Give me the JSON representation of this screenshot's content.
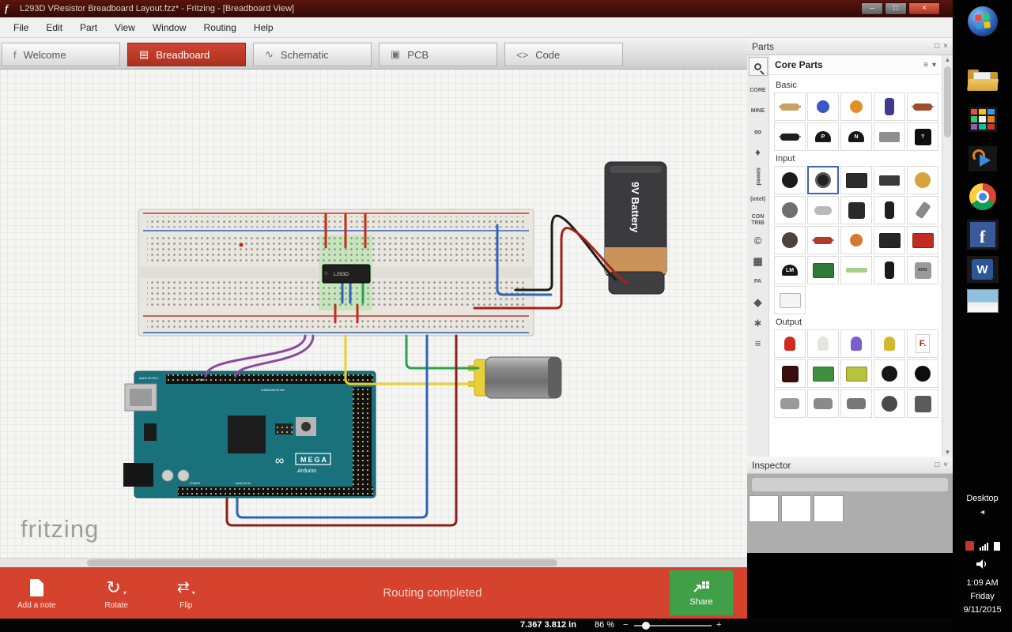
{
  "colors": {
    "accent_red": "#c0392b",
    "toolbar_red": "#d5432e",
    "share_green": "#3fa047",
    "selection_blue": "#3a66ad",
    "title_bar": "#3c0f0a"
  },
  "window": {
    "title": "L293D VResistor Breadboard Layout.fzz* - Fritzing - [Breadboard View]",
    "app_glyph": "f",
    "minimize_glyph": "–",
    "maximize_glyph": "□",
    "close_glyph": "×"
  },
  "menu": {
    "items": [
      "File",
      "Edit",
      "Part",
      "View",
      "Window",
      "Routing",
      "Help"
    ]
  },
  "tabs": [
    {
      "label": "Welcome",
      "icon": "f",
      "active": false
    },
    {
      "label": "Breadboard",
      "icon": "▤",
      "active": true
    },
    {
      "label": "Schematic",
      "icon": "∿",
      "active": false
    },
    {
      "label": "PCB",
      "icon": "▣",
      "active": false
    },
    {
      "label": "Code",
      "icon": "<>",
      "active": false
    }
  ],
  "canvas": {
    "watermark": "fritzing",
    "battery_label": "9V Battery",
    "chip_label": "L293D",
    "mega_label": "MEGA",
    "brand_label": "Arduino",
    "infinity_glyph": "∞",
    "made_in": "MADE IN ITALY",
    "communication": "COMMUNICATION",
    "pwm_label": "PWM",
    "analog_label": "ANALOG IN",
    "power_label": "POWER"
  },
  "parts_panel": {
    "title": "Parts",
    "bin_title": "Core Parts",
    "menu_glyph": "≡",
    "caret_glyph": "▾",
    "dock_glyph": "□",
    "close_glyph": "×",
    "scroll_up": "▲",
    "scroll_down": "▼",
    "side_tabs": [
      {
        "n": "bin-tab-core",
        "t": "CORE"
      },
      {
        "n": "bin-tab-mine",
        "t": "MINE"
      },
      {
        "n": "bin-tab-adafruit",
        "t": "∞",
        "big": true
      },
      {
        "n": "bin-tab-sparkfun",
        "t": "♦",
        "big": true
      },
      {
        "n": "bin-tab-seeed",
        "t": "seeed",
        "rot": true
      },
      {
        "n": "bin-tab-intel",
        "t": "(intel)"
      },
      {
        "n": "bin-tab-contrib",
        "t": "CON\nTRIB"
      },
      {
        "n": "bin-tab-parallax",
        "t": "©",
        "big": true
      },
      {
        "n": "bin-tab-picaxe",
        "t": "▦",
        "big": true
      },
      {
        "n": "bin-tab-pa",
        "t": "PA"
      },
      {
        "n": "bin-tab-velleman",
        "t": "◆",
        "big": true
      },
      {
        "n": "bin-tab-snootlab",
        "t": "∗",
        "big": true
      },
      {
        "n": "bin-tab-more",
        "t": "≡",
        "big": true
      }
    ],
    "sections": [
      {
        "label": "Basic",
        "items": [
          {
            "n": "resistor-icon",
            "g": "axial",
            "c": "#c9a25f"
          },
          {
            "n": "ceramic-capacitor-icon",
            "g": "disc",
            "c": "#3a57c4"
          },
          {
            "n": "tantalum-capacitor-icon",
            "g": "disc",
            "c": "#e09124"
          },
          {
            "n": "electrolytic-capacitor-icon",
            "g": "can",
            "c": "#3d3a8f"
          },
          {
            "n": "inductor-icon",
            "g": "axial",
            "c": "#a34b2c"
          },
          {
            "n": "diode-icon",
            "g": "axial",
            "c": "#1f1f1f"
          },
          {
            "n": "pnp-transistor-icon",
            "g": "half",
            "c": "#161616",
            "t": "P"
          },
          {
            "n": "npn-transistor-icon",
            "g": "half",
            "c": "#161616",
            "t": "N"
          },
          {
            "n": "ic-dip-icon",
            "g": "dip",
            "c": "#8f8f8f"
          },
          {
            "n": "mystery-part-icon",
            "g": "sq",
            "c": "#0d0d0d",
            "t": "?"
          }
        ]
      },
      {
        "label": "Input",
        "items": [
          {
            "n": "basic-potentiometer-icon",
            "g": "circle",
            "c": "#1b1b1b"
          },
          {
            "n": "rotary-potentiometer-icon",
            "g": "knob",
            "c": "#202020",
            "sel": true
          },
          {
            "n": "slide-potentiometer-icon",
            "g": "board",
            "c": "#2c2c2c"
          },
          {
            "n": "dip-switch-icon",
            "g": "dip",
            "c": "#3a3a3a"
          },
          {
            "n": "trimmer-potentiometer-icon",
            "g": "circle",
            "c": "#d8a33c"
          },
          {
            "n": "rotary-encoder-icon",
            "g": "circle",
            "c": "#6f6f6f"
          },
          {
            "n": "crystal-icon",
            "g": "oval",
            "c": "#b9b9b9"
          },
          {
            "n": "pushbutton-icon",
            "g": "sq",
            "c": "#2a2a2a"
          },
          {
            "n": "tilt-switch-icon",
            "g": "can",
            "c": "#1f1f1f"
          },
          {
            "n": "microphone-icon",
            "g": "tilt",
            "c": "#8a8a8a"
          },
          {
            "n": "photoresistor-icon",
            "g": "circle",
            "c": "#4e423c"
          },
          {
            "n": "thermistor-icon",
            "g": "axial",
            "c": "#b23a2a"
          },
          {
            "n": "light-sensor-icon",
            "g": "disc",
            "c": "#d8772f"
          },
          {
            "n": "distance-sensor-icon",
            "g": "board",
            "c": "#262626"
          },
          {
            "n": "sparkfun-sensor-board-icon",
            "g": "board",
            "c": "#c22c22"
          },
          {
            "n": "lm35-temperature-sensor-icon",
            "g": "half",
            "c": "#161616",
            "t": "LM"
          },
          {
            "n": "sensor-module-icon",
            "g": "board",
            "c": "#2f7a3a"
          },
          {
            "n": "flex-sensor-icon",
            "g": "strip",
            "c": "#a9cf8e"
          },
          {
            "n": "probe-electrode-icon",
            "g": "can",
            "c": "#1a1a1a"
          },
          {
            "n": "rfid-id12-module-icon",
            "g": "sq",
            "c": "#9a9a9a",
            "t": "RFID",
            "tc": "#333333"
          },
          {
            "n": "mini-breadboard-icon",
            "g": "board",
            "c": "#f4f4f4"
          }
        ]
      },
      {
        "label": "Output",
        "items": [
          {
            "n": "red-led-icon",
            "g": "led",
            "c": "#cf2a1f"
          },
          {
            "n": "white-led-icon",
            "g": "led",
            "c": "#e4e4e0"
          },
          {
            "n": "rgb-led-icon",
            "g": "led",
            "c": "#7a5ed0"
          },
          {
            "n": "bi-color-led-icon",
            "g": "led",
            "c": "#d3b92e"
          },
          {
            "n": "seven-segment-display-icon",
            "g": "seg",
            "c": "#ffffff",
            "t": "F.",
            "tc": "#cc1111"
          },
          {
            "n": "led-matrix-icon",
            "g": "sq",
            "c": "#3a0d0d"
          },
          {
            "n": "lcd-16x2-icon",
            "g": "board",
            "c": "#3f8f3f"
          },
          {
            "n": "lcd-display-icon",
            "g": "board",
            "c": "#b9c23f"
          },
          {
            "n": "piezo-buzzer-icon",
            "g": "circle",
            "c": "#161616"
          },
          {
            "n": "loudspeaker-icon",
            "g": "circle",
            "c": "#0d0d0d"
          },
          {
            "n": "vibration-motor-icon",
            "g": "can2",
            "c": "#9a9a9a"
          },
          {
            "n": "dc-motor-icon",
            "g": "can2",
            "c": "#8a8a8a"
          },
          {
            "n": "gear-motor-icon",
            "g": "can2",
            "c": "#777777"
          },
          {
            "n": "stepper-motor-icon",
            "g": "circle",
            "c": "#4a4a4a"
          },
          {
            "n": "servo-motor-icon",
            "g": "sq",
            "c": "#5a5a5a"
          }
        ]
      }
    ]
  },
  "inspector": {
    "title": "Inspector",
    "dock_glyph": "□",
    "close_glyph": "×"
  },
  "toolbar": {
    "add_note": "Add a note",
    "rotate": "Rotate",
    "flip": "Flip",
    "caret": "▾",
    "rotate_glyph": "↻",
    "flip_glyph": "⇄",
    "status": "Routing completed",
    "share": "Share"
  },
  "statusbar": {
    "coords": "7.367 3.812 in",
    "zoom": "86 %",
    "minus": "−",
    "plus": "+"
  },
  "desktop": {
    "label": "Desktop",
    "collapse_glyph": "◄",
    "facebook_letter": "f",
    "word_letter": "W",
    "clock": {
      "time": "1:09 AM",
      "day": "Friday",
      "date": "9/11/2015"
    },
    "grid_colors": [
      "#e74c3c",
      "#f1c40f",
      "#3498db",
      "#2ecc71",
      "#ecf0f1",
      "#e67e22",
      "#9b59b6",
      "#1abc9c",
      "#c0392b"
    ],
    "flag_colors": [
      "#e74c3c",
      "#2ecc71",
      "#3498db",
      "#f1c40f"
    ]
  }
}
